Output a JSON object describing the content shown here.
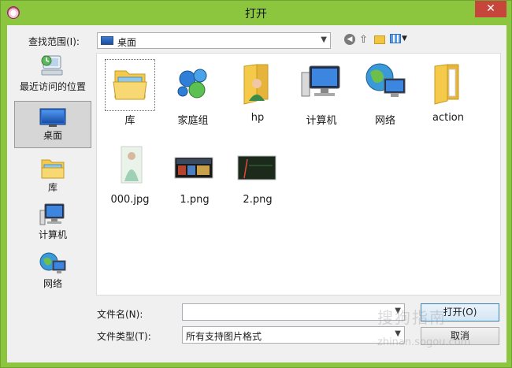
{
  "window": {
    "title": "打开",
    "close_label": "✕"
  },
  "lookin": {
    "label": "查找范围(I):",
    "value": "桌面"
  },
  "places": [
    {
      "label": "最近访问的位置",
      "icon": "recent-places-icon"
    },
    {
      "label": "桌面",
      "icon": "desktop-icon",
      "selected": true
    },
    {
      "label": "库",
      "icon": "library-icon"
    },
    {
      "label": "计算机",
      "icon": "computer-icon"
    },
    {
      "label": "网络",
      "icon": "network-icon"
    }
  ],
  "files": [
    {
      "label": "库",
      "icon": "library-folder-icon"
    },
    {
      "label": "家庭组",
      "icon": "homegroup-icon"
    },
    {
      "label": "hp",
      "icon": "user-folder-icon"
    },
    {
      "label": "计算机",
      "icon": "computer-icon"
    },
    {
      "label": "网络",
      "icon": "network-icon"
    },
    {
      "label": "action",
      "icon": "folder-icon"
    },
    {
      "label": "000.jpg",
      "icon": "image-thumbnail-icon"
    },
    {
      "label": "1.png",
      "icon": "image-thumbnail-icon"
    },
    {
      "label": "2.png",
      "icon": "image-thumbnail-icon"
    }
  ],
  "filename": {
    "label": "文件名(N):",
    "value": ""
  },
  "filetype": {
    "label": "文件类型(T):",
    "value": "所有支持图片格式"
  },
  "buttons": {
    "open": "打开(O)",
    "cancel": "取消"
  },
  "watermark": {
    "text": "搜狗指南",
    "url": "zhinan.sogou.com"
  }
}
